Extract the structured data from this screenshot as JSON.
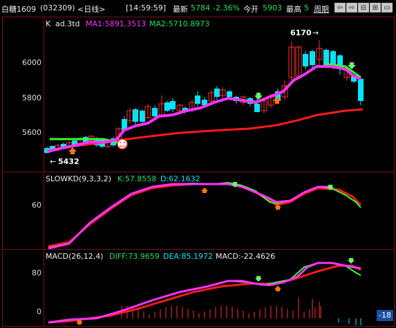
{
  "header": {
    "instrument": "白糖1609",
    "code": "(032309)",
    "period": "<日线>",
    "time": "[14:59:59]",
    "latest_label": "最新",
    "latest_value": "5784",
    "change_pct": "-2.36%",
    "open_label": "今开",
    "open_value": "5903",
    "high_label": "最高",
    "high_value": "5",
    "period_button": "周期",
    "nav_buttons": [
      "⇦",
      "⇨",
      "⊟",
      "⊞",
      "▭"
    ]
  },
  "price_panel": {
    "k_label": "K",
    "indicator_name": "ad.3td",
    "ma1_label": "MA1:5891.3513",
    "ma2_label": "MA2:5710.8973",
    "y_ticks": [
      "6000",
      "5800",
      "5600"
    ],
    "high_marker": "6170",
    "low_marker": "5432"
  },
  "kd_panel": {
    "title": "SLOWKD(9,3,3,2)",
    "k_label": "K:57.8558",
    "d_label": "D:62.1632",
    "y_ticks": [
      "60"
    ]
  },
  "macd_panel": {
    "title": "MACD(26,12,4)",
    "diff_label": "DIFF:73.9659",
    "dea_label": "DEA:85.1972",
    "macd_label": "MACD:-22.4626",
    "y_ticks": [
      "80",
      "0"
    ]
  },
  "scroll_badge": "-18",
  "colors": {
    "up": "#ff3030",
    "down": "#00e5ff",
    "ma1": "#ff33ff",
    "ma2": "#ff1a1a",
    "green_line": "#33ff33",
    "cyan_label": "#00e5ff",
    "grid_border": "#7a1010"
  }
}
